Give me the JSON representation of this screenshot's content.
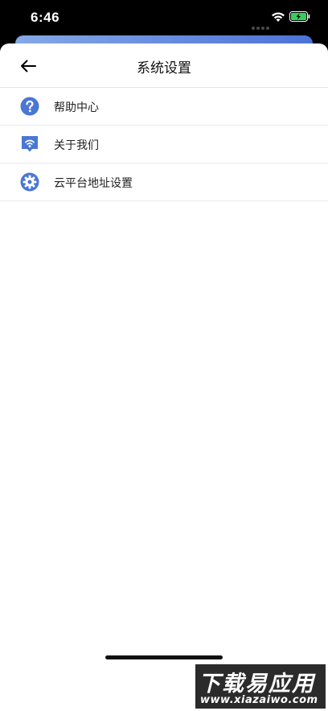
{
  "status": {
    "time": "6:46"
  },
  "header": {
    "title": "系统设置"
  },
  "menu": [
    {
      "label": "帮助中心",
      "icon": "help-icon"
    },
    {
      "label": "关于我们",
      "icon": "about-us-icon"
    },
    {
      "label": "云平台地址设置",
      "icon": "settings-gear-icon"
    }
  ],
  "watermark": {
    "main": "下载易应用",
    "sub": "www.xiazaiwo.com"
  },
  "colors": {
    "accent": "#4a77d4",
    "battery": "#30d158"
  }
}
